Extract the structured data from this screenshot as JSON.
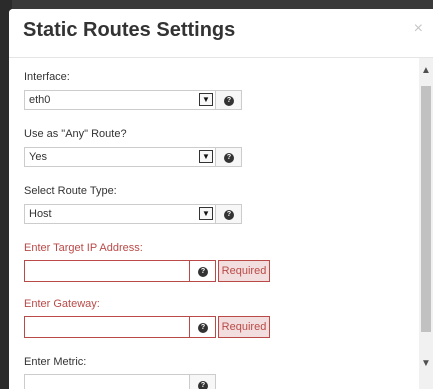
{
  "dialog": {
    "title": "Static Routes Settings",
    "close_glyph": "×"
  },
  "fields": {
    "interface": {
      "label": "Interface:",
      "value": "eth0"
    },
    "any_route": {
      "label": "Use as \"Any\" Route?",
      "value": "Yes"
    },
    "route_type": {
      "label": "Select Route Type:",
      "value": "Host"
    },
    "target_ip": {
      "label": "Enter Target IP Address:",
      "value": "",
      "badge": "Required"
    },
    "gateway": {
      "label": "Enter Gateway:",
      "value": "",
      "badge": "Required"
    },
    "metric": {
      "label": "Enter Metric:",
      "value": ""
    }
  },
  "icons": {
    "help": "question-circle-icon",
    "caret": "chevron-down-icon"
  },
  "colors": {
    "error": "#b94a48",
    "error_bg": "#f2dede"
  }
}
